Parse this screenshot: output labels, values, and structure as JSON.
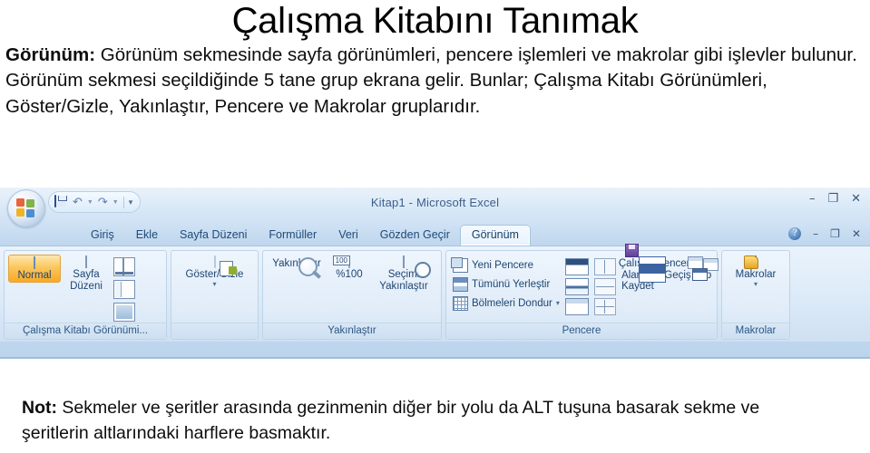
{
  "slide": {
    "title": "Çalışma Kitabını Tanımak",
    "paragraph_lead": "Görünüm:",
    "paragraph_rest": " Görünüm sekmesinde sayfa görünümleri, pencere işlemleri ve makrolar gibi işlevler bulunur. Görünüm sekmesi seçildiğinde 5 tane grup ekrana gelir. Bunlar; Çalışma Kitabı Görünümleri, Göster/Gizle, Yakınlaştır, Pencere ve Makrolar gruplarıdır.",
    "note_lead": "Not:",
    "note_rest": " Sekmeler ve şeritler arasında gezinmenin diğer bir yolu da ALT tuşuna basarak sekme ve şeritlerin altlarındaki harflere basmaktır."
  },
  "excel": {
    "titlebar": {
      "document_title": "Kitap1 - Microsoft Excel",
      "office_button": "Office",
      "quick_access": [
        "save-icon",
        "undo-icon",
        "redo-icon",
        "customize-icon"
      ],
      "window_controls": [
        "–",
        "❐",
        "✕"
      ]
    },
    "tabs": [
      {
        "label": "Giriş",
        "active": false
      },
      {
        "label": "Ekle",
        "active": false
      },
      {
        "label": "Sayfa Düzeni",
        "active": false
      },
      {
        "label": "Formüller",
        "active": false
      },
      {
        "label": "Veri",
        "active": false
      },
      {
        "label": "Gözden Geçir",
        "active": false
      },
      {
        "label": "Görünüm",
        "active": true
      }
    ],
    "tab_right_controls": {
      "help": "?",
      "minimize": "–",
      "restore": "❐",
      "close": "✕"
    },
    "groups": [
      {
        "name": "Çalışma Kitabı Görünümi...",
        "buttons": [
          {
            "label": "Normal",
            "selected": true
          },
          {
            "label": "Sayfa Düzeni",
            "selected": false
          }
        ],
        "small_buttons": [
          "page-break-preview-icon",
          "custom-views-icon",
          "full-screen-icon"
        ]
      },
      {
        "name": "",
        "buttons": [
          {
            "label": "Göster/Gizle",
            "selected": false,
            "has_dropdown": true
          }
        ]
      },
      {
        "name": "Yakınlaştır",
        "buttons": [
          {
            "label": "Yakınlaştır",
            "selected": false
          },
          {
            "label": "%100",
            "selected": false
          },
          {
            "label": "Seçimi Yakınlaştır",
            "selected": false
          }
        ]
      },
      {
        "name": "Pencere",
        "commands": [
          {
            "label": "Yeni Pencere",
            "has_dropdown": false
          },
          {
            "label": "Tümünü Yerleştir",
            "has_dropdown": false
          },
          {
            "label": "Bölmeleri Dondur",
            "has_dropdown": true
          }
        ],
        "buttons": [
          {
            "label": "Çalışma Alanını Kaydet",
            "selected": false
          },
          {
            "label": "Pencerelerde Geçiş Yap",
            "selected": false,
            "has_dropdown": true
          }
        ]
      },
      {
        "name": "Makrolar",
        "buttons": [
          {
            "label": "Makrolar",
            "selected": false,
            "has_dropdown": true
          }
        ]
      }
    ],
    "zoom_badge": "100"
  },
  "colors": {
    "ribbon_blue": "#cfe0f2",
    "ribbon_text": "#1d4570",
    "selected_orange": "#f8a825",
    "slide_text": "#0d0d0d"
  }
}
